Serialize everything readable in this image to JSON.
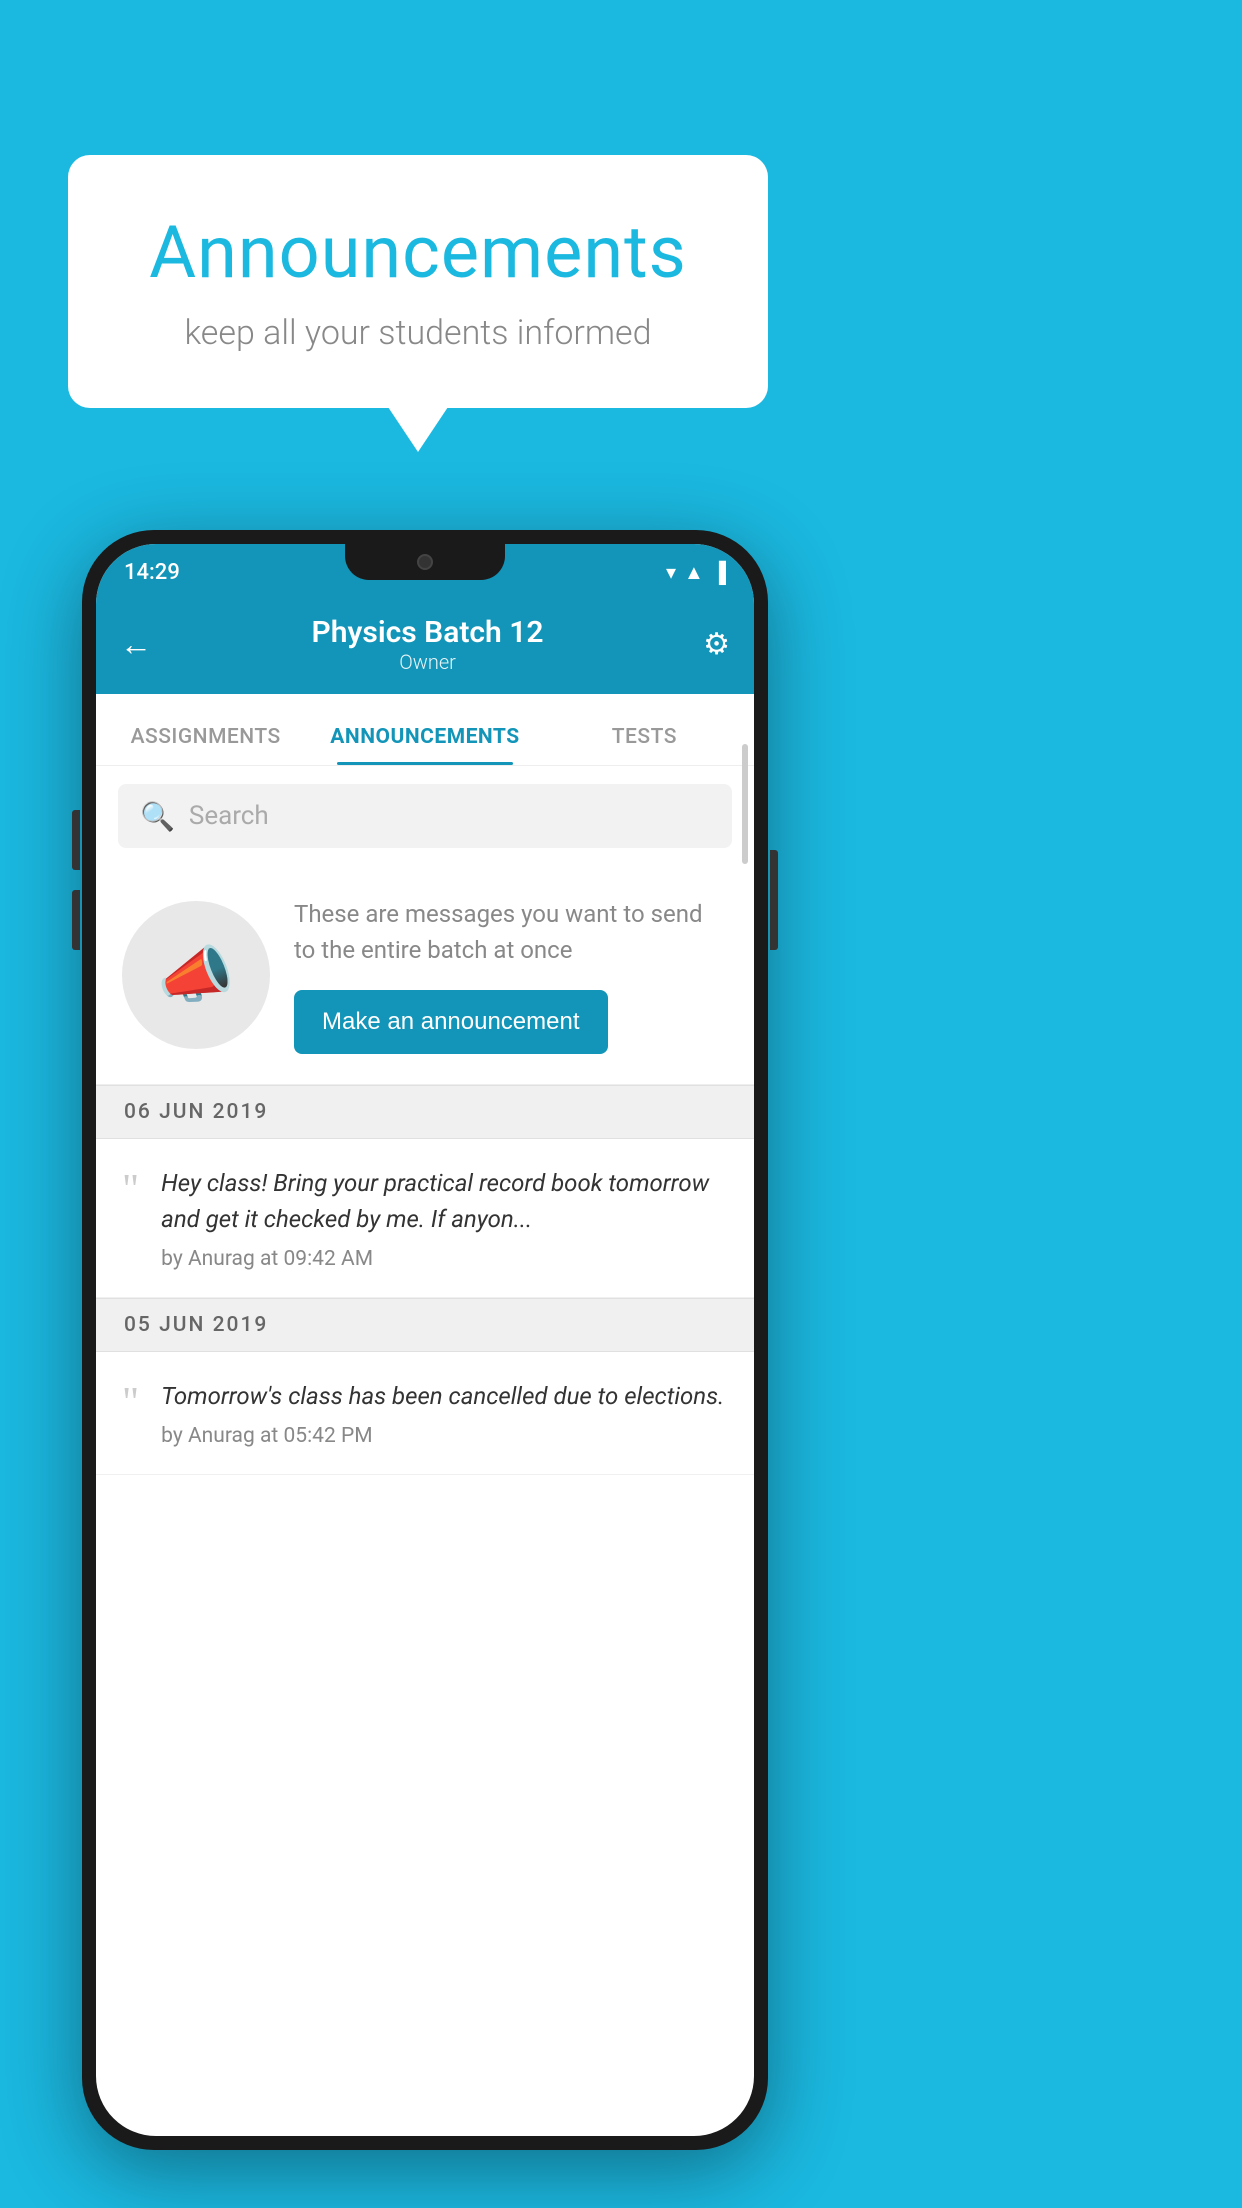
{
  "background_color": "#1BB8E0",
  "speech_bubble": {
    "title": "Announcements",
    "subtitle": "keep all your students informed"
  },
  "phone": {
    "status_bar": {
      "time": "14:29",
      "icons": [
        "wifi",
        "signal",
        "battery"
      ]
    },
    "header": {
      "title": "Physics Batch 12",
      "subtitle": "Owner",
      "back_label": "←",
      "gear_label": "⚙"
    },
    "tabs": [
      {
        "label": "ASSIGNMENTS",
        "active": false
      },
      {
        "label": "ANNOUNCEMENTS",
        "active": true
      },
      {
        "label": "TESTS",
        "active": false
      },
      {
        "label": "...",
        "active": false
      }
    ],
    "search": {
      "placeholder": "Search"
    },
    "promo": {
      "description": "These are messages you want to send to the entire batch at once",
      "button_label": "Make an announcement"
    },
    "announcements": [
      {
        "date": "06  JUN  2019",
        "text": "Hey class! Bring your practical record book tomorrow and get it checked by me. If anyon...",
        "meta": "by Anurag at 09:42 AM"
      },
      {
        "date": "05  JUN  2019",
        "text": "Tomorrow's class has been cancelled due to elections.",
        "meta": "by Anurag at 05:42 PM"
      }
    ]
  }
}
